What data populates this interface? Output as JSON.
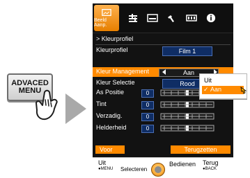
{
  "remote": {
    "button_line1": "ADVACED",
    "button_line2": "MENU"
  },
  "tabs": {
    "active_label": "Beeld Aanp.",
    "icons": [
      "picture-adjust-icon",
      "equalizer-icon",
      "display-icon",
      "wrench-icon",
      "memory-icon",
      "info-icon"
    ]
  },
  "menu": {
    "breadcrumb": "> Kleurprofiel",
    "profile_label": "Kleurprofiel",
    "profile_value": "Film 1",
    "rows": [
      {
        "label": "Kleur Management",
        "value": "Aan"
      },
      {
        "label": "Kleur Selectie",
        "value": "Rood"
      },
      {
        "label": "As Positie",
        "num": "0",
        "level": 0.5
      },
      {
        "label": "Tint",
        "num": "0",
        "level": 0.5
      },
      {
        "label": "Verzadig.",
        "num": "0",
        "level": 0.5
      },
      {
        "label": "Helderheid",
        "num": "0",
        "level": 0.5
      }
    ],
    "buttons": {
      "left": "Voor",
      "right": "Terugzetten"
    }
  },
  "footer": {
    "exit_label": "Uit",
    "exit_sub": "●MENU",
    "select_label": "Selecteren",
    "operate_label": "Bedienen",
    "back_label": "Terug",
    "back_sub": "●BACK"
  },
  "popup": {
    "options": [
      "Uit",
      "Aan"
    ],
    "selected_index": 1
  }
}
